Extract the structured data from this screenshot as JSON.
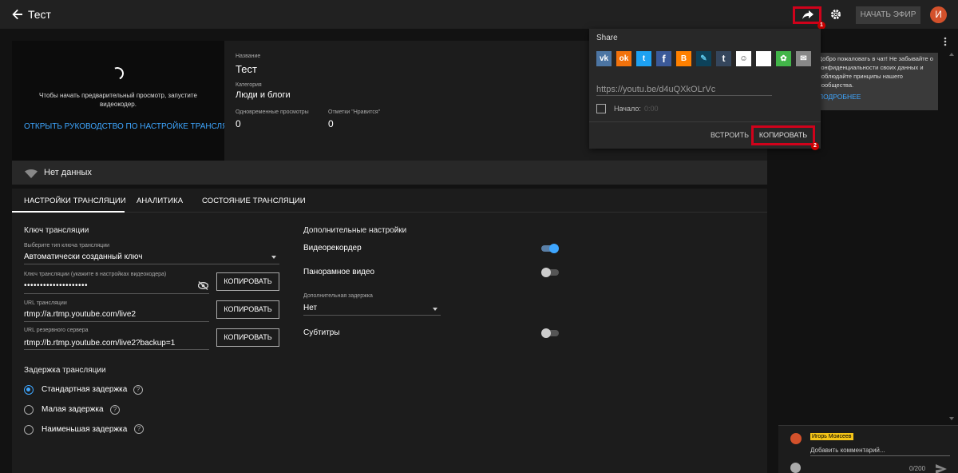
{
  "header": {
    "title": "Тест",
    "start_label": "НАЧАТЬ ЭФИР",
    "avatar_letter": "И",
    "badge_1": "1"
  },
  "preview": {
    "message": "Чтобы начать предварительный просмотр, запустите видеокодер.",
    "guide_link": "ОТКРЫТЬ РУКОВОДСТВО ПО НАСТРОЙКЕ ТРАНСЛЯЦИИ"
  },
  "info": {
    "name_label": "Название",
    "name_value": "Тест",
    "category_label": "Категория",
    "category_value": "Люди и блоги",
    "concurrent_label": "Одновременные просмотры",
    "concurrent_value": "0",
    "likes_label": "Отметки \"Нравится\"",
    "likes_value": "0"
  },
  "status": {
    "text": "Нет данных"
  },
  "tabs": [
    "НАСТРОЙКИ ТРАНСЛЯЦИИ",
    "АНАЛИТИКА",
    "СОСТОЯНИЕ ТРАНСЛЯЦИИ"
  ],
  "stream_key": {
    "title": "Ключ трансляции",
    "type_label": "Выберите тип ключа трансляции",
    "type_value": "Автоматически созданный ключ",
    "key_label": "Ключ трансляции (укажите в настройках видеокодера)",
    "key_value": "••••••••••••••••••••",
    "url_label": "URL трансляции",
    "url_value": "rtmp://a.rtmp.youtube.com/live2",
    "backup_label": "URL резервного сервера",
    "backup_value": "rtmp://b.rtmp.youtube.com/live2?backup=1",
    "copy_label": "КОПИРОВАТЬ"
  },
  "latency": {
    "title": "Задержка трансляции",
    "options": [
      "Стандартная задержка",
      "Малая задержка",
      "Наименьшая задержка"
    ],
    "selected_index": 0
  },
  "advanced": {
    "title": "Дополнительные настройки",
    "dvr_label": "Видеорекордер",
    "dvr_on": true,
    "pano_label": "Панорамное видео",
    "pano_on": false,
    "delay_label": "Дополнительная задержка",
    "delay_value": "Нет",
    "subs_label": "Субтитры",
    "subs_on": false
  },
  "share": {
    "title": "Share",
    "icons": [
      "vk-icon",
      "odnoklassniki-icon",
      "twitter-icon",
      "facebook-icon",
      "blogger-icon",
      "livejournal-icon",
      "tumblr-icon",
      "reddit-icon",
      "blank-icon",
      "mixi-icon",
      "email-icon"
    ],
    "icon_colors": [
      "#4c75a3",
      "#f2720c",
      "#1da1f2",
      "#3b5998",
      "#ff8000",
      "#0d425a",
      "#35465c",
      "#ffffff",
      "#ffffff",
      "#42b549",
      "#888888"
    ],
    "url": "https://youtu.be/d4uQXkOLrVc",
    "start_label": "Начало:",
    "start_time": "0:00",
    "embed_label": "ВСТРОИТЬ",
    "copy_label": "КОПИРОВАТЬ",
    "badge_2": "2"
  },
  "chat": {
    "welcome": "Добро пожаловать в чат! Не забывайте о конфиденциальности своих данных и соблюдайте принципы нашего сообщества.",
    "more_label": "ПОДРОБНЕЕ",
    "user_name": "Игорь Моисеев",
    "input_placeholder": "Добавить комментарий...",
    "counter": "0/200"
  },
  "colors": {
    "accent": "#3ea6ff",
    "highlight": "#d0021b",
    "avatar": "#d3512b"
  }
}
